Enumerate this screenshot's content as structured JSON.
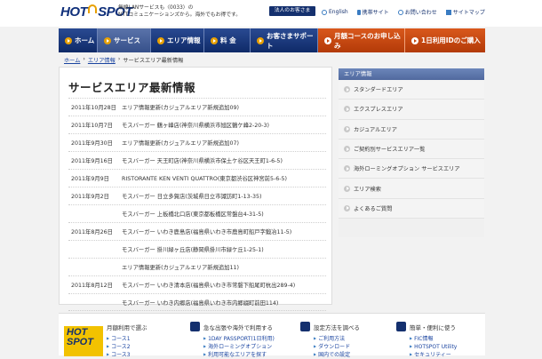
{
  "header": {
    "logo_hot": "HOT",
    "logo_spot": "SPOT",
    "tagline_line1": "無線LANサービスも〈0033〉の",
    "tagline_line2": "NTTコミュニケーションズから。海外でもお得です。",
    "corporate_button": "法人のお客さま",
    "links": [
      "English",
      "携帯サイト",
      "お問い合わせ",
      "サイトマップ"
    ]
  },
  "nav": {
    "items": [
      "ホーム",
      "サービス",
      "エリア情報",
      "料 金",
      "お客さまサポート"
    ],
    "promo_items": [
      "月額コースのお申し込み",
      "1日利用IDのご購入"
    ]
  },
  "breadcrumb": {
    "home": "ホーム",
    "sep1": "›",
    "area": "エリア情報",
    "sep2": "›",
    "current": "サービスエリア最新情報"
  },
  "main": {
    "title": "サービスエリア最新情報",
    "news": [
      {
        "date": "2011年10月28日",
        "text": "エリア情報更新(カジュアルエリア新規追加09)"
      },
      {
        "date": "2011年10月7日",
        "text": "モスバーガー 鶴ヶ峰店(神奈川県横浜市旭区鶴ケ峰2-20-3)"
      },
      {
        "date": "2011年9月30日",
        "text": "エリア情報更新(カジュアルエリア新規追加07)"
      },
      {
        "date": "2011年9月16日",
        "text": "モスバーガー 天王町店(神奈川県横浜市保土ケ谷区天王町1-6-5)"
      },
      {
        "date": "2011年9月9日",
        "text": "RISTORANTE KEN VENTI QUATTRO(東京都渋谷区神宮前5-6-5)"
      },
      {
        "date": "2011年9月2日",
        "text": "モスバーガー 日立多賀店(茨城県日立市諏訪町1-13-35)"
      },
      {
        "date": "",
        "text": "モスバーガー 上板橋北口店(東京都板橋区常盤台4-31-5)"
      },
      {
        "date": "2011年8月26日",
        "text": "モスバーガー いわき鹿島店(福島県いわき市鹿島町船戸字鍛冶11-5)"
      },
      {
        "date": "",
        "text": "モスバーガー 掛川緑ヶ丘店(静岡県掛川市緑ケ丘1-25-1)"
      },
      {
        "date": "",
        "text": "エリア情報更新(カジュアルエリア新規追加11)"
      },
      {
        "date": "2011年8月12日",
        "text": "モスバーガー いわき清本店(福島県いわき市常磐下船尾町杭出289-4)"
      },
      {
        "date": "",
        "text": "モスバーガー いわき内郷店(福島県いわき市内郷綴町前田114)"
      }
    ]
  },
  "sidebar": {
    "title": "エリア情報",
    "items": [
      "スタンダードエリア",
      "エクスプレスエリア",
      "カジュアルエリア",
      "ご契約別サービスエリア一覧",
      "海外ローミングオプション サービスエリア",
      "エリア検索",
      "よくあるご質問"
    ]
  },
  "bottom": {
    "promo_hot": "HOT",
    "promo_spot": "SPOT",
    "col1": {
      "title": "月額利用で選ぶ",
      "items": [
        "コース1",
        "コース2",
        "コース3"
      ]
    },
    "col2": {
      "title": "急な出張や海外で利用する",
      "items": [
        "1DAY PASSPORT(1日利用)",
        "海外ローミングオプション",
        "利用可能なエリアを探す"
      ]
    },
    "col3": {
      "title": "設定方法を調べる",
      "items": [
        "ご利用方法",
        "ダウンロード",
        "国内での設定"
      ]
    },
    "col4": {
      "title": "簡単・便利に使う",
      "items": [
        "FIC情報",
        "HOTSPOT Utility",
        "セキュリティー"
      ]
    }
  }
}
